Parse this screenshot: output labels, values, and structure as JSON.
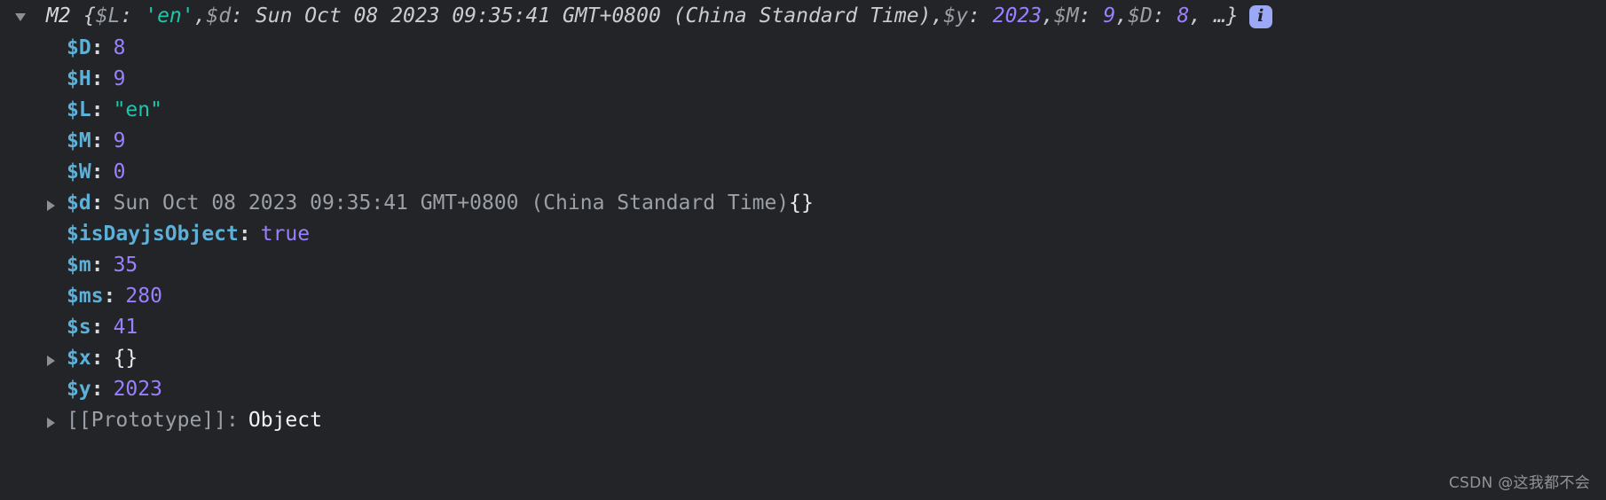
{
  "console": {
    "background_color": "#232428",
    "header": {
      "expand_icon": "triangle-down-icon",
      "constructor_name": "M2",
      "open_brace": "{",
      "close_brace": ", …}",
      "preview_entries": [
        {
          "key": "$L",
          "separator": ": ",
          "value": "'en'",
          "type": "string",
          "trailing": ", "
        },
        {
          "key": "$d",
          "separator": ": ",
          "value": "Sun Oct 08 2023 09:35:41 GMT+0800 (China Standard Time)",
          "type": "date",
          "trailing": ", "
        },
        {
          "key": "$y",
          "separator": ": ",
          "value": "2023",
          "type": "number",
          "trailing": ", "
        },
        {
          "key": "$M",
          "separator": ": ",
          "value": "9",
          "type": "number",
          "trailing": ", "
        },
        {
          "key": "$D",
          "separator": ": ",
          "value": "8",
          "type": "number",
          "trailing": ""
        }
      ],
      "info_badge": {
        "icon": "info-icon",
        "label": "i",
        "background_color": "#9aa8f5"
      }
    },
    "properties": [
      {
        "expandable": false,
        "icon": "",
        "key": "$D",
        "colon": ":",
        "value": "8",
        "type": "number"
      },
      {
        "expandable": false,
        "icon": "",
        "key": "$H",
        "colon": ":",
        "value": "9",
        "type": "number"
      },
      {
        "expandable": false,
        "icon": "",
        "key": "$L",
        "colon": ":",
        "value": "\"en\"",
        "type": "string"
      },
      {
        "expandable": false,
        "icon": "",
        "key": "$M",
        "colon": ":",
        "value": "9",
        "type": "number"
      },
      {
        "expandable": false,
        "icon": "",
        "key": "$W",
        "colon": ":",
        "value": "0",
        "type": "number"
      },
      {
        "expandable": true,
        "icon": "triangle-right-icon",
        "key": "$d",
        "colon": ":",
        "value": "Sun Oct 08 2023 09:35:41 GMT+0800 (China Standard Time)",
        "type": "date",
        "suffix": "{}"
      },
      {
        "expandable": false,
        "icon": "",
        "key": "$isDayjsObject",
        "colon": ":",
        "value": "true",
        "type": "boolean"
      },
      {
        "expandable": false,
        "icon": "",
        "key": "$m",
        "colon": ":",
        "value": "35",
        "type": "number"
      },
      {
        "expandable": false,
        "icon": "",
        "key": "$ms",
        "colon": ":",
        "value": "280",
        "type": "number"
      },
      {
        "expandable": false,
        "icon": "",
        "key": "$s",
        "colon": ":",
        "value": "41",
        "type": "number"
      },
      {
        "expandable": true,
        "icon": "triangle-right-icon",
        "key": "$x",
        "colon": ":",
        "value": "{}",
        "type": "object"
      },
      {
        "expandable": false,
        "icon": "",
        "key": "$y",
        "colon": ":",
        "value": "2023",
        "type": "number"
      },
      {
        "expandable": true,
        "icon": "triangle-right-icon",
        "key": "[[Prototype]]",
        "colon": ":",
        "value": "Object",
        "type": "prototype"
      }
    ],
    "watermark": "CSDN @这我都不会",
    "colors": {
      "key": "#5db0d7",
      "number": "#9a7fff",
      "string": "#1bc7ab",
      "grey_text": "#9aa0a6",
      "white_text": "#e6e8ea",
      "triangle": "#8d8f93"
    }
  }
}
